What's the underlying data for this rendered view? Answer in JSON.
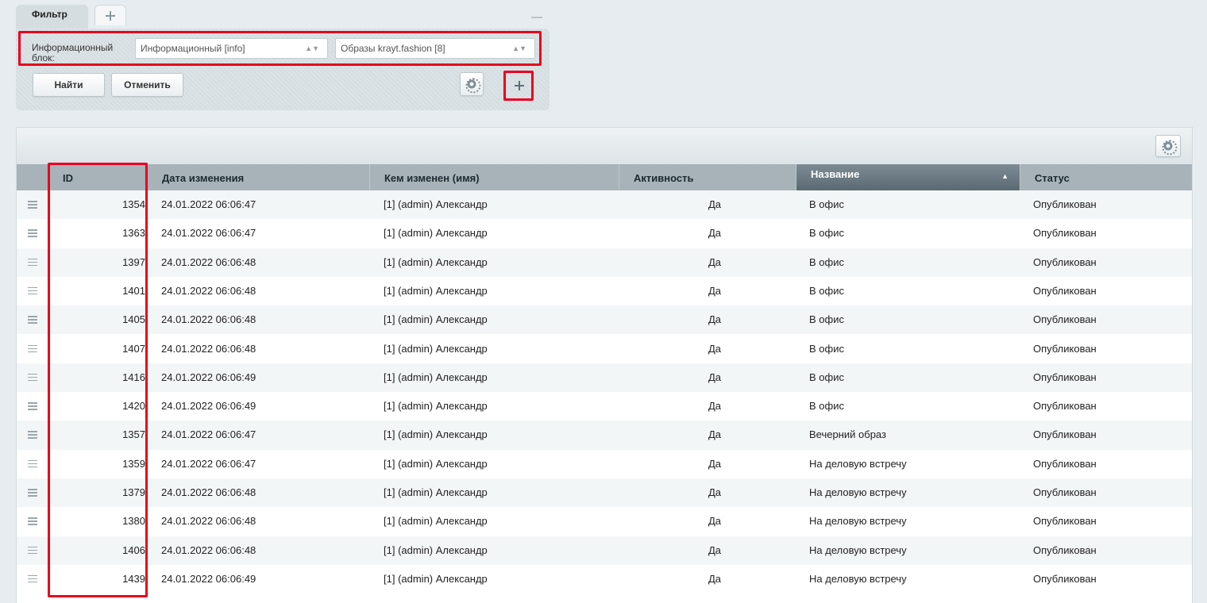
{
  "filter": {
    "tab_label": "Фильтр",
    "field_label": "Информационный блок:",
    "select_type_value": "Информационный [info]",
    "select_iblock_value": "Образы krayt.fashion [8]",
    "find_label": "Найти",
    "cancel_label": "Отменить"
  },
  "grid": {
    "columns": {
      "id": "ID",
      "date": "Дата изменения",
      "user": "Кем изменен (имя)",
      "active": "Активность",
      "name": "Название",
      "status": "Статус"
    },
    "sorted_column": "Название",
    "rows": [
      {
        "id": "1354",
        "date": "24.01.2022 06:06:47",
        "user": "[1] (admin) Александр",
        "active": "Да",
        "name": "В офис",
        "status": "Опубликован"
      },
      {
        "id": "1363",
        "date": "24.01.2022 06:06:47",
        "user": "[1] (admin) Александр",
        "active": "Да",
        "name": "В офис",
        "status": "Опубликован"
      },
      {
        "id": "1397",
        "date": "24.01.2022 06:06:48",
        "user": "[1] (admin) Александр",
        "active": "Да",
        "name": "В офис",
        "status": "Опубликован"
      },
      {
        "id": "1401",
        "date": "24.01.2022 06:06:48",
        "user": "[1] (admin) Александр",
        "active": "Да",
        "name": "В офис",
        "status": "Опубликован"
      },
      {
        "id": "1405",
        "date": "24.01.2022 06:06:48",
        "user": "[1] (admin) Александр",
        "active": "Да",
        "name": "В офис",
        "status": "Опубликован"
      },
      {
        "id": "1407",
        "date": "24.01.2022 06:06:48",
        "user": "[1] (admin) Александр",
        "active": "Да",
        "name": "В офис",
        "status": "Опубликован"
      },
      {
        "id": "1416",
        "date": "24.01.2022 06:06:49",
        "user": "[1] (admin) Александр",
        "active": "Да",
        "name": "В офис",
        "status": "Опубликован"
      },
      {
        "id": "1420",
        "date": "24.01.2022 06:06:49",
        "user": "[1] (admin) Александр",
        "active": "Да",
        "name": "В офис",
        "status": "Опубликован"
      },
      {
        "id": "1357",
        "date": "24.01.2022 06:06:47",
        "user": "[1] (admin) Александр",
        "active": "Да",
        "name": "Вечерний образ",
        "status": "Опубликован"
      },
      {
        "id": "1359",
        "date": "24.01.2022 06:06:47",
        "user": "[1] (admin) Александр",
        "active": "Да",
        "name": "На деловую встречу",
        "status": "Опубликован"
      },
      {
        "id": "1379",
        "date": "24.01.2022 06:06:48",
        "user": "[1] (admin) Александр",
        "active": "Да",
        "name": "На деловую встречу",
        "status": "Опубликован"
      },
      {
        "id": "1380",
        "date": "24.01.2022 06:06:48",
        "user": "[1] (admin) Александр",
        "active": "Да",
        "name": "На деловую встречу",
        "status": "Опубликован"
      },
      {
        "id": "1406",
        "date": "24.01.2022 06:06:48",
        "user": "[1] (admin) Александр",
        "active": "Да",
        "name": "На деловую встречу",
        "status": "Опубликован"
      },
      {
        "id": "1439",
        "date": "24.01.2022 06:06:49",
        "user": "[1] (admin) Александр",
        "active": "Да",
        "name": "На деловую встречу",
        "status": "Опубликован"
      }
    ]
  },
  "icons": {
    "add_tab": "plus-icon",
    "minimize": "minus-icon",
    "settings": "gear-icon",
    "add_filter_field": "plus-icon",
    "drag": "drag-handle-icon",
    "sort": "sort-asc-icon"
  },
  "colors": {
    "highlight": "#e8001f",
    "sorted_header": "#5b6a72"
  }
}
